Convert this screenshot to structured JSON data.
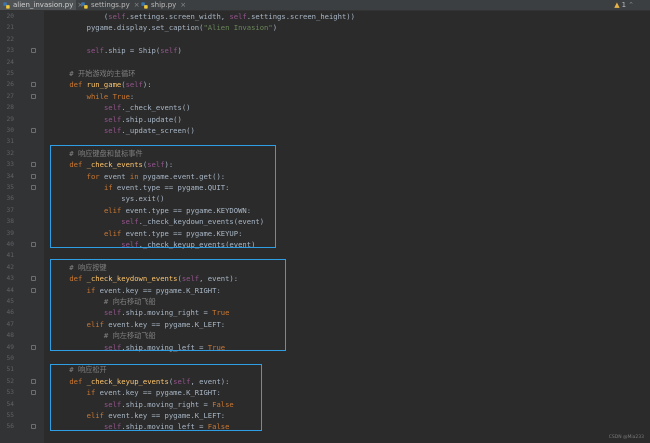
{
  "tabs": [
    {
      "label": "alien_invasion.py",
      "active": true
    },
    {
      "label": "settings.py",
      "active": false
    },
    {
      "label": "ship.py",
      "active": false
    }
  ],
  "inspection": {
    "count": "1"
  },
  "colors": {
    "highlight": "#2f9fe5",
    "keyword": "#cc7832",
    "self": "#94558d",
    "function": "#ffc66d",
    "string": "#6a8759",
    "comment": "#808080"
  },
  "lines": [
    {
      "n": "20",
      "fold": false,
      "tokens": [
        [
          "t",
          "            ("
        ],
        [
          "self",
          "self"
        ],
        [
          "t",
          ".settings.screen_width, "
        ],
        [
          "self",
          "self"
        ],
        [
          "t",
          ".settings.screen_height))"
        ]
      ]
    },
    {
      "n": "21",
      "fold": false,
      "tokens": [
        [
          "t",
          "        pygame.display.set_caption("
        ],
        [
          "str",
          "\"Alien Invasion\""
        ],
        [
          "t",
          ")"
        ]
      ]
    },
    {
      "n": "22",
      "fold": false,
      "tokens": []
    },
    {
      "n": "23",
      "fold": true,
      "tokens": [
        [
          "t",
          "        "
        ],
        [
          "self",
          "self"
        ],
        [
          "t",
          ".ship = Ship("
        ],
        [
          "self",
          "self"
        ],
        [
          "t",
          ")"
        ]
      ]
    },
    {
      "n": "24",
      "fold": false,
      "tokens": []
    },
    {
      "n": "25",
      "fold": false,
      "tokens": [
        [
          "cm",
          "    # 开始游戏的主循环"
        ]
      ]
    },
    {
      "n": "26",
      "fold": true,
      "tokens": [
        [
          "t",
          "    "
        ],
        [
          "kw",
          "def "
        ],
        [
          "fn",
          "run_game"
        ],
        [
          "t",
          "("
        ],
        [
          "self",
          "self"
        ],
        [
          "t",
          "):"
        ]
      ]
    },
    {
      "n": "27",
      "fold": true,
      "tokens": [
        [
          "t",
          "        "
        ],
        [
          "kw",
          "while True"
        ],
        [
          "t",
          ":"
        ]
      ]
    },
    {
      "n": "28",
      "fold": false,
      "tokens": [
        [
          "t",
          "            "
        ],
        [
          "self",
          "self"
        ],
        [
          "t",
          "._check_events()"
        ]
      ]
    },
    {
      "n": "29",
      "fold": false,
      "tokens": [
        [
          "t",
          "            "
        ],
        [
          "self",
          "self"
        ],
        [
          "t",
          ".ship.update()"
        ]
      ]
    },
    {
      "n": "30",
      "fold": true,
      "tokens": [
        [
          "t",
          "            "
        ],
        [
          "self",
          "self"
        ],
        [
          "t",
          "._update_screen()"
        ]
      ]
    },
    {
      "n": "31",
      "fold": false,
      "tokens": []
    },
    {
      "n": "32",
      "fold": false,
      "tokens": [
        [
          "cm",
          "    # 响应键盘和鼠标事件"
        ]
      ]
    },
    {
      "n": "33",
      "fold": true,
      "tokens": [
        [
          "t",
          "    "
        ],
        [
          "kw",
          "def "
        ],
        [
          "fn",
          "_check_events"
        ],
        [
          "t",
          "("
        ],
        [
          "self",
          "self"
        ],
        [
          "t",
          "):"
        ]
      ]
    },
    {
      "n": "34",
      "fold": true,
      "tokens": [
        [
          "t",
          "        "
        ],
        [
          "kw",
          "for "
        ],
        [
          "t",
          "event "
        ],
        [
          "kw",
          "in "
        ],
        [
          "t",
          "pygame.event.get():"
        ]
      ]
    },
    {
      "n": "35",
      "fold": true,
      "tokens": [
        [
          "t",
          "            "
        ],
        [
          "kw",
          "if "
        ],
        [
          "t",
          "event.type == pygame.QUIT:"
        ]
      ]
    },
    {
      "n": "36",
      "fold": false,
      "tokens": [
        [
          "t",
          "                sys.exit()"
        ]
      ]
    },
    {
      "n": "37",
      "fold": false,
      "tokens": [
        [
          "t",
          "            "
        ],
        [
          "kw",
          "elif "
        ],
        [
          "t",
          "event.type == pygame.KEYDOWN:"
        ]
      ]
    },
    {
      "n": "38",
      "fold": false,
      "tokens": [
        [
          "t",
          "                "
        ],
        [
          "self",
          "self"
        ],
        [
          "t",
          "._check_keydown_events(event)"
        ]
      ]
    },
    {
      "n": "39",
      "fold": false,
      "tokens": [
        [
          "t",
          "            "
        ],
        [
          "kw",
          "elif "
        ],
        [
          "t",
          "event.type == pygame.KEYUP:"
        ]
      ]
    },
    {
      "n": "40",
      "fold": true,
      "tokens": [
        [
          "t",
          "                "
        ],
        [
          "self",
          "self"
        ],
        [
          "t",
          "._check_keyup_events(event)"
        ]
      ]
    },
    {
      "n": "41",
      "fold": false,
      "tokens": []
    },
    {
      "n": "42",
      "fold": false,
      "tokens": [
        [
          "cm",
          "    # 响应按键"
        ]
      ]
    },
    {
      "n": "43",
      "fold": true,
      "tokens": [
        [
          "t",
          "    "
        ],
        [
          "kw",
          "def "
        ],
        [
          "fn",
          "_check_keydown_events"
        ],
        [
          "t",
          "("
        ],
        [
          "self",
          "self"
        ],
        [
          "t",
          ", event):"
        ]
      ]
    },
    {
      "n": "44",
      "fold": true,
      "tokens": [
        [
          "t",
          "        "
        ],
        [
          "kw",
          "if "
        ],
        [
          "t",
          "event.key == pygame.K_RIGHT:"
        ]
      ]
    },
    {
      "n": "45",
      "fold": false,
      "tokens": [
        [
          "cm",
          "            # 向右移动飞船"
        ]
      ]
    },
    {
      "n": "46",
      "fold": false,
      "tokens": [
        [
          "t",
          "            "
        ],
        [
          "self",
          "self"
        ],
        [
          "t",
          ".ship.moving_right = "
        ],
        [
          "kw",
          "True"
        ]
      ]
    },
    {
      "n": "47",
      "fold": false,
      "tokens": [
        [
          "t",
          "        "
        ],
        [
          "kw",
          "elif "
        ],
        [
          "t",
          "event.key == pygame.K_LEFT:"
        ]
      ]
    },
    {
      "n": "48",
      "fold": false,
      "tokens": [
        [
          "cm",
          "            # 向左移动飞船"
        ]
      ]
    },
    {
      "n": "49",
      "fold": true,
      "tokens": [
        [
          "t",
          "            "
        ],
        [
          "self",
          "self"
        ],
        [
          "t",
          ".ship.moving_left = "
        ],
        [
          "kw",
          "True"
        ]
      ]
    },
    {
      "n": "50",
      "fold": false,
      "tokens": []
    },
    {
      "n": "51",
      "fold": false,
      "tokens": [
        [
          "cm",
          "    # 响应松开"
        ]
      ]
    },
    {
      "n": "52",
      "fold": true,
      "tokens": [
        [
          "t",
          "    "
        ],
        [
          "kw",
          "def "
        ],
        [
          "fn",
          "_check_keyup_events"
        ],
        [
          "t",
          "("
        ],
        [
          "self",
          "self"
        ],
        [
          "t",
          ", event):"
        ]
      ]
    },
    {
      "n": "53",
      "fold": true,
      "tokens": [
        [
          "t",
          "        "
        ],
        [
          "kw",
          "if "
        ],
        [
          "t",
          "event.key == pygame.K_RIGHT:"
        ]
      ]
    },
    {
      "n": "54",
      "fold": false,
      "tokens": [
        [
          "t",
          "            "
        ],
        [
          "self",
          "self"
        ],
        [
          "t",
          ".ship.moving_right = "
        ],
        [
          "kw",
          "False"
        ]
      ]
    },
    {
      "n": "55",
      "fold": false,
      "tokens": [
        [
          "t",
          "        "
        ],
        [
          "kw",
          "elif "
        ],
        [
          "t",
          "event.key == pygame.K_LEFT:"
        ]
      ]
    },
    {
      "n": "56",
      "fold": true,
      "tokens": [
        [
          "t",
          "            "
        ],
        [
          "self",
          "self"
        ],
        [
          "t",
          ".ship.moving_left = "
        ],
        [
          "kw",
          "False"
        ]
      ]
    }
  ],
  "watermark": "CSDN @Mia233"
}
